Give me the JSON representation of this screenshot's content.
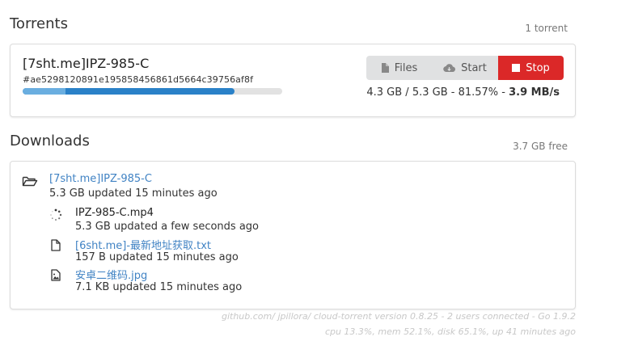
{
  "torrents": {
    "title": "Torrents",
    "count_label": "1 torrent",
    "items": [
      {
        "name": "[7sht.me]IPZ-985-C",
        "hash": "#ae5298120891e195858456861d5664c39756af8f",
        "progress_percent": 81.57,
        "buttons": {
          "files": "Files",
          "start": "Start",
          "stop": "Stop"
        },
        "stats_prefix": "4.3 GB / 5.3 GB - 81.57% - ",
        "speed": "3.9 MB/s"
      }
    ]
  },
  "downloads": {
    "title": "Downloads",
    "free_label": "3.7 GB free",
    "folder": {
      "name": "[7sht.me]IPZ-985-C",
      "meta": "5.3 GB updated 15 minutes ago"
    },
    "files": [
      {
        "icon": "spinner-icon",
        "name": "IPZ-985-C.mp4",
        "meta": "5.3 GB updated a few seconds ago",
        "link": false
      },
      {
        "icon": "file-icon",
        "name": "[6sht.me]-最新地址获取.txt",
        "meta": "157 B updated 15 minutes ago",
        "link": true
      },
      {
        "icon": "image-file-icon",
        "name": "安卓二维码.jpg",
        "meta": "7.1 KB updated 15 minutes ago",
        "link": true
      }
    ]
  },
  "footer": {
    "line1": "github.com/ jpillora/ cloud-torrent version 0.8.25 - 2 users connected - Go 1.9.2",
    "line2": "cpu 13.3%, mem 52.1%, disk 65.1%, up 41 minutes ago"
  },
  "colors": {
    "accent": "#2a81c8",
    "stop": "#db2828",
    "link": "#4183c4"
  }
}
